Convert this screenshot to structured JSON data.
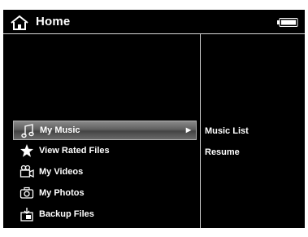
{
  "header": {
    "title": "Home",
    "home_icon": "home-icon",
    "battery_icon": "battery-icon"
  },
  "menu": {
    "items": [
      {
        "label": "My Music",
        "icon": "music-note-icon",
        "selected": true
      },
      {
        "label": "View Rated Files",
        "icon": "star-icon",
        "selected": false
      },
      {
        "label": "My Videos",
        "icon": "video-camera-icon",
        "selected": false
      },
      {
        "label": "My Photos",
        "icon": "camera-icon",
        "selected": false
      },
      {
        "label": "Backup Files",
        "icon": "backup-icon",
        "selected": false
      }
    ]
  },
  "submenu": {
    "items": [
      {
        "label": "Music List"
      },
      {
        "label": "Resume"
      }
    ]
  },
  "colors": {
    "background": "#000000",
    "text": "#ffffff",
    "selection": "#6a6a6a"
  }
}
